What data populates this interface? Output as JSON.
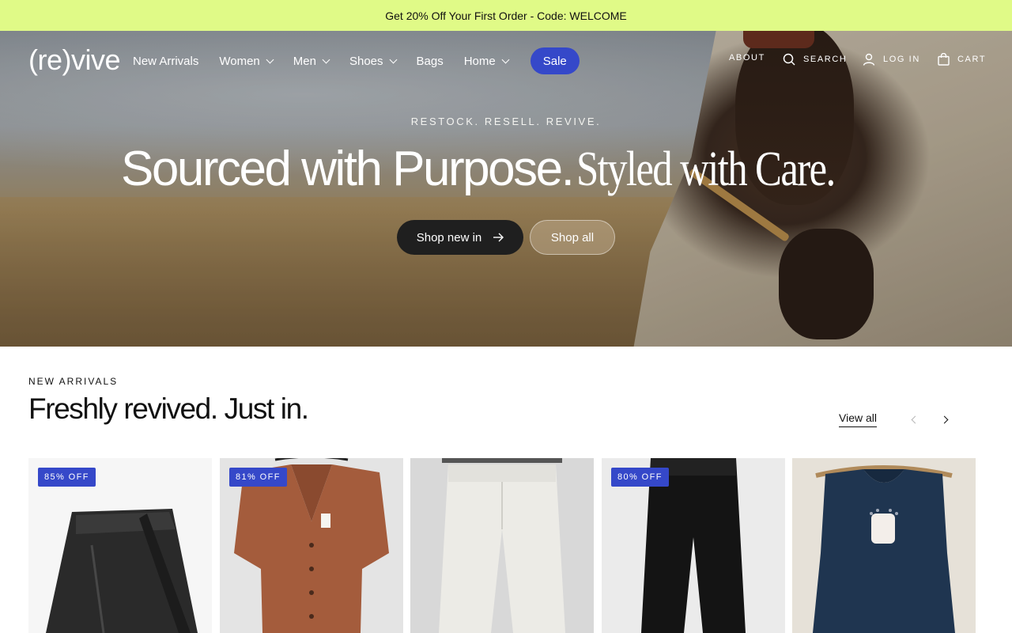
{
  "announcement": "Get 20% Off Your First Order - Code: WELCOME",
  "brand": {
    "logo": "(re)vive"
  },
  "nav": {
    "items": [
      {
        "label": "New Arrivals",
        "dropdown": false
      },
      {
        "label": "Women",
        "dropdown": true
      },
      {
        "label": "Men",
        "dropdown": true
      },
      {
        "label": "Shoes",
        "dropdown": true
      },
      {
        "label": "Bags",
        "dropdown": false
      },
      {
        "label": "Home",
        "dropdown": true
      }
    ],
    "sale": "Sale",
    "about": "ABOUT",
    "search": "SEARCH",
    "login": "LOG IN",
    "cart": "CART",
    "accent": "#3548c9"
  },
  "hero": {
    "eyebrow": "RESTOCK. RESELL. REVIVE.",
    "headline_sans": "Sourced with Purpose.",
    "headline_serif": "Styled with Care.",
    "primary_cta": "Shop new in",
    "secondary_cta": "Shop all"
  },
  "section": {
    "eyebrow": "NEW ARRIVALS",
    "title": "Freshly revived. Just in.",
    "view_all": "View all"
  },
  "products": [
    {
      "badge": "85% OFF",
      "item": "black leather wrap skirt",
      "bg": "#f4f4f4"
    },
    {
      "badge": "81% OFF",
      "item": "rust button-front dress",
      "bg": "#e6e6e6"
    },
    {
      "badge": "",
      "item": "light grey trousers",
      "bg": "#dcdcdc"
    },
    {
      "badge": "80% OFF",
      "item": "black trousers",
      "bg": "#ededed"
    },
    {
      "badge": "",
      "item": "navy sleeveless top",
      "bg": "#e9e5de"
    }
  ],
  "banner_color": "#e0fa87"
}
